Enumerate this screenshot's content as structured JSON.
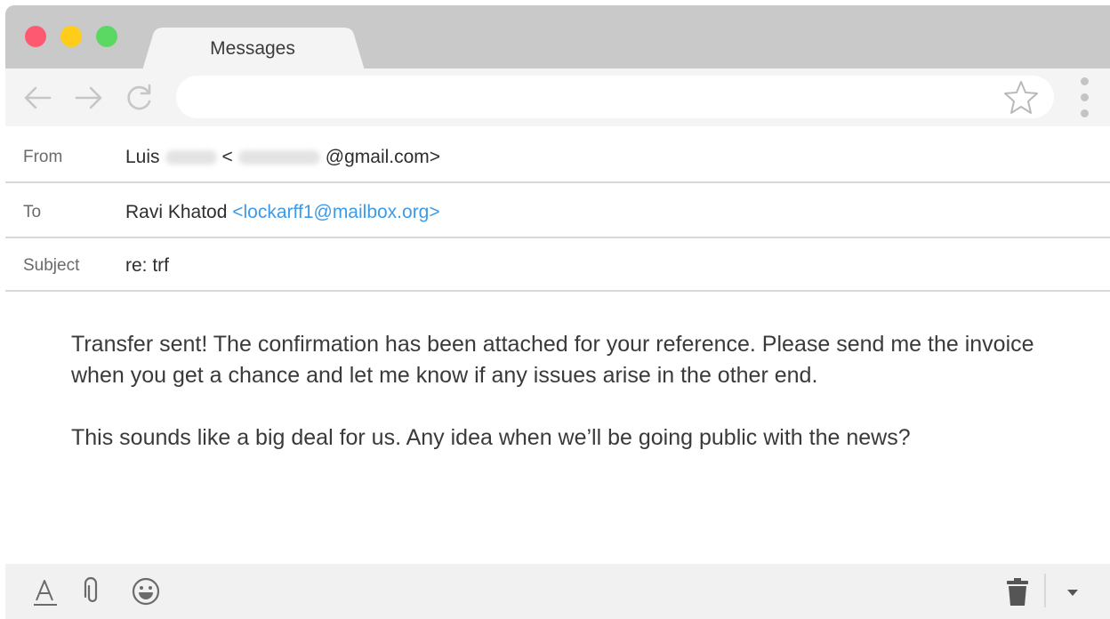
{
  "window": {
    "tab_title": "Messages"
  },
  "toolbar": {
    "url": "",
    "icons": [
      "back-arrow-icon",
      "forward-arrow-icon",
      "reload-icon",
      "bookmark-star-icon",
      "more-menu-icon"
    ]
  },
  "email": {
    "from": {
      "label": "From",
      "name_visible": "Luis",
      "open_bracket": "<",
      "domain_visible": "@gmail.com>"
    },
    "to": {
      "label": "To",
      "name": "Ravi Khatod",
      "address": "<lockarff1@mailbox.org>"
    },
    "subject": {
      "label": "Subject",
      "value": "re: trf"
    },
    "body": {
      "paragraph1": "Transfer sent! The confirmation has been attached for your reference. Please send me the invoice when you get a chance and let me know if any issues arise in the other end.",
      "paragraph2": "This sounds like a big deal for us. Any idea when we’ll be going public with the news?"
    }
  },
  "compose_toolbar": {
    "icons": [
      "text-format-icon",
      "attachment-icon",
      "emoji-icon",
      "trash-icon",
      "dropdown-arrow-icon"
    ]
  },
  "colors": {
    "traffic_red": "#fd5a71",
    "traffic_yellow": "#fdcd1a",
    "traffic_green": "#5bd863",
    "link_blue": "#3d9ae8"
  }
}
